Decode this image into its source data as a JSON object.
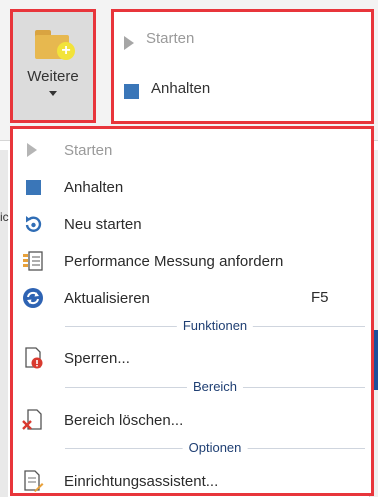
{
  "ribbon": {
    "more_button": {
      "label": "Weitere",
      "icon": "folder-add-icon"
    },
    "control_group": {
      "start_label": "Starten",
      "stop_label": "Anhalten"
    }
  },
  "background": {
    "fragment_text": "ic"
  },
  "menu": {
    "items": [
      {
        "label": "Starten",
        "icon": "play-icon",
        "enabled": false
      },
      {
        "label": "Anhalten",
        "icon": "stop-icon",
        "enabled": true
      },
      {
        "label": "Neu starten",
        "icon": "restart-icon",
        "enabled": true
      },
      {
        "label": "Performance Messung anfordern",
        "icon": "performance-icon",
        "enabled": true
      },
      {
        "label": "Aktualisieren",
        "icon": "refresh-icon",
        "shortcut": "F5",
        "enabled": true
      }
    ],
    "section_funktionen": "Funktionen",
    "sperren_label": "Sperren...",
    "section_bereich": "Bereich",
    "bereich_loeschen_label": "Bereich löschen...",
    "section_optionen": "Optionen",
    "einrichtung_label": "Einrichtungsassistent..."
  },
  "colors": {
    "highlight_border": "#e8353b",
    "accent_blue": "#3a76b8",
    "section_label": "#1f3f73",
    "disabled_text": "#9a9a9a"
  }
}
